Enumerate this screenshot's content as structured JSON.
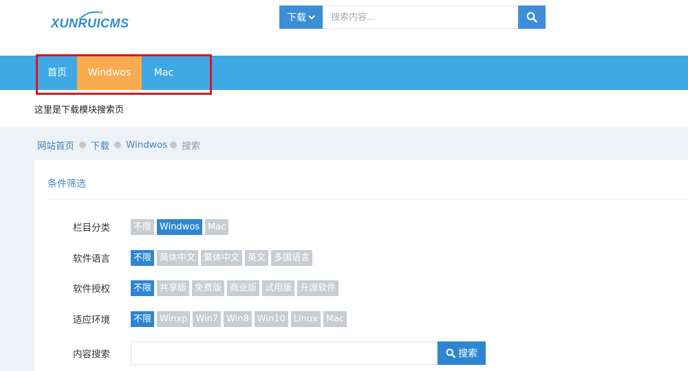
{
  "logo": {
    "text": "XUNRUICMS"
  },
  "search": {
    "type_label": "下载",
    "placeholder": "搜索内容..."
  },
  "nav": {
    "items": [
      {
        "label": "首页"
      },
      {
        "label": "Windwos"
      },
      {
        "label": "Mac"
      }
    ]
  },
  "page_description": "这里是下载模块搜索页",
  "breadcrumb": {
    "items": [
      {
        "label": "网站首页"
      },
      {
        "label": "下载"
      },
      {
        "label": "Windwos"
      },
      {
        "label": "搜索"
      }
    ]
  },
  "filter": {
    "title": "条件筛选",
    "rows": [
      {
        "label": "栏目分类",
        "options": [
          "不限",
          "Windwos",
          "Mac"
        ],
        "selected": "Windwos"
      },
      {
        "label": "软件语言",
        "options": [
          "不限",
          "简体中文",
          "繁体中文",
          "英文",
          "多国语言"
        ],
        "selected": "不限"
      },
      {
        "label": "软件授权",
        "options": [
          "不限",
          "共享版",
          "免费版",
          "商业版",
          "试用版",
          "开源软件"
        ],
        "selected": "不限"
      },
      {
        "label": "适应环境",
        "options": [
          "不限",
          "Winxp",
          "Win7",
          "Win8",
          "Win10",
          "Linux",
          "Mac"
        ],
        "selected": "不限"
      }
    ],
    "keyword_label": "内容搜索",
    "keyword_value": "",
    "search_button": "搜索"
  },
  "colors": {
    "nav_bg": "#3fa9e6",
    "nav_active": "#f9ac4f",
    "accent": "#2e86d1",
    "highlight": "#e1131c"
  }
}
